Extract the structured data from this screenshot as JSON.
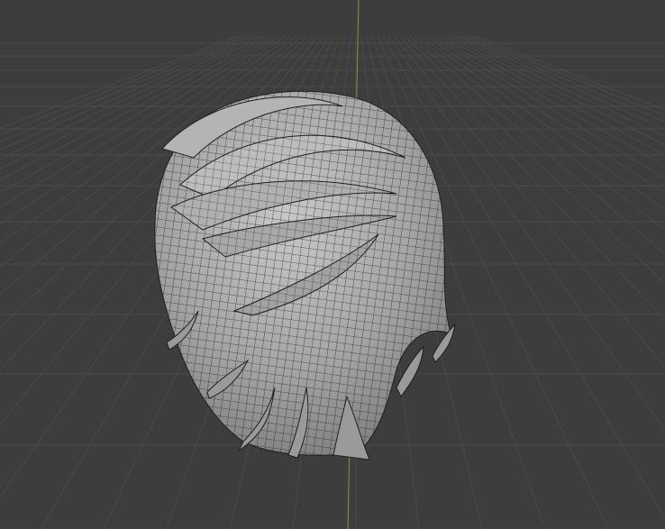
{
  "app": {
    "view": "3D Viewport",
    "shading": "solid",
    "overlay": "wireframe"
  },
  "scene": {
    "object": "hair-mesh",
    "grid_visible": true,
    "z_axis_visible": true
  },
  "colors": {
    "background": "#3d3d3d",
    "grid_line": "#4a4a4a",
    "z_axis": "#7a9a3e",
    "mesh_fill": "#9d9d9d",
    "mesh_light": "#c2c2c2",
    "wire": "#1f1f1f"
  }
}
